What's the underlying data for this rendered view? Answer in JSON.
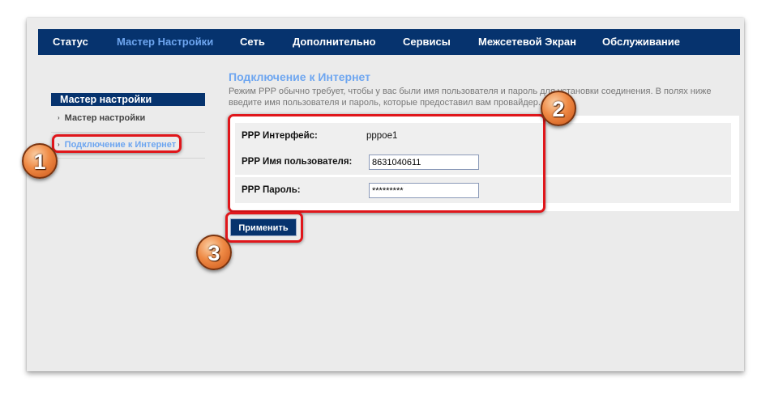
{
  "nav": {
    "items": [
      {
        "label": "Статус"
      },
      {
        "label": "Мастер Настройки"
      },
      {
        "label": "Сеть"
      },
      {
        "label": "Дополнительно"
      },
      {
        "label": "Сервисы"
      },
      {
        "label": "Межсетевой Экран"
      },
      {
        "label": "Обслуживание"
      }
    ],
    "active_index": 1
  },
  "sidebar": {
    "heading": "Мастер настройки",
    "items": [
      {
        "label": "Мастер настройки",
        "bullet": "›"
      },
      {
        "label": "Подключение к Интернет",
        "bullet": "›"
      }
    ],
    "active_index": 1
  },
  "main": {
    "title": "Подключение к Интернет",
    "description": "Режим PPP обычно требует, чтобы у вас были имя пользователя и пароль для установки соединения. В полях ниже введите имя пользователя и пароль, которые предоставил вам провайдер.",
    "form": {
      "interface_label": "PPP Интерфейс:",
      "interface_value": "pppoe1",
      "username_label": "PPP Имя пользователя:",
      "username_value": "8631040611",
      "password_label": "PPP Пароль:",
      "password_value": "*********"
    },
    "apply_label": "Применить"
  },
  "annotations": {
    "badges": [
      "1",
      "2",
      "3"
    ]
  },
  "colors": {
    "nav_bg": "#06336e",
    "accent": "#6ea6f0",
    "highlight": "#e0161b",
    "badge": "#ef8a45"
  }
}
